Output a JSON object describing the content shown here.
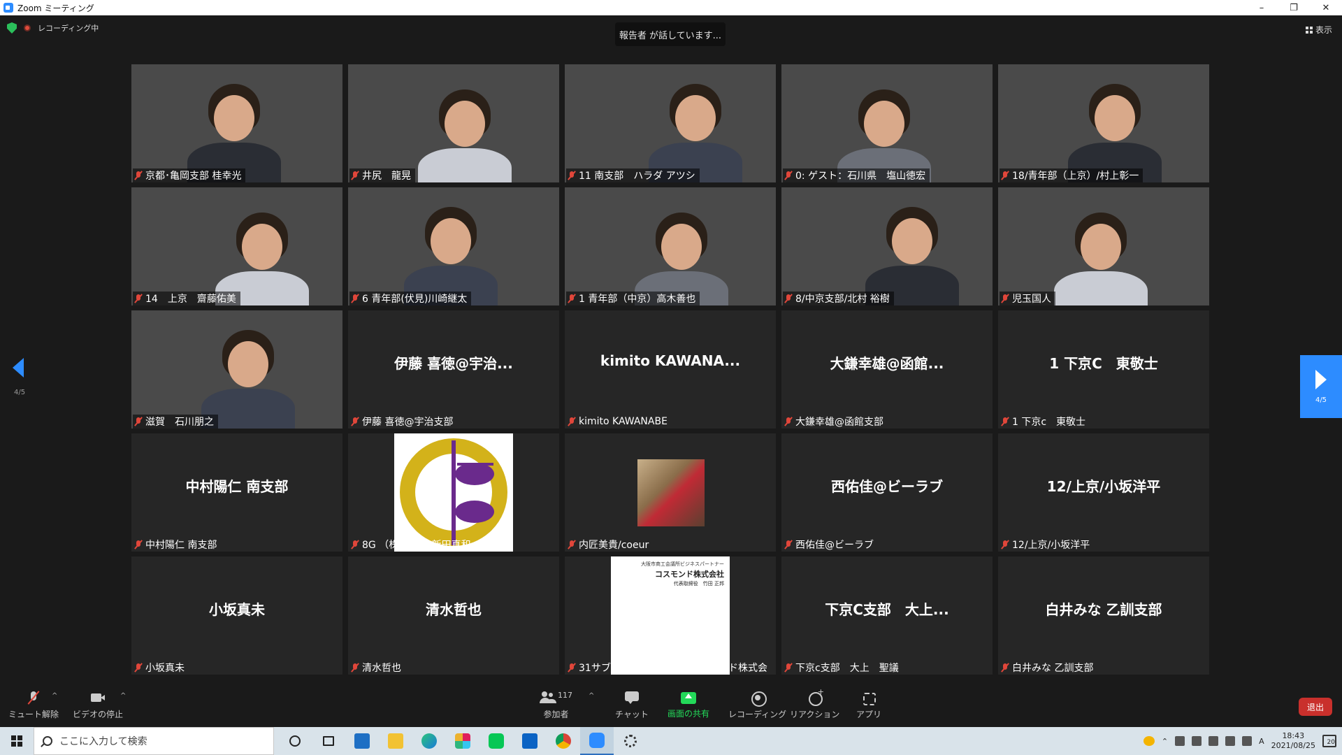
{
  "window": {
    "title": "Zoom ミーティング",
    "min": "–",
    "max": "❐",
    "close": "✕"
  },
  "meeting": {
    "recording_label": "レコーディング中",
    "speaking_banner": "報告者 が話しています...",
    "view_label": "表示",
    "page_indicator": "4/5"
  },
  "tiles": [
    {
      "name": "京都･亀岡支部 桂幸光",
      "kind": "video",
      "bg": "room"
    },
    {
      "name": "井尻　龍晃",
      "kind": "video",
      "bg": "office"
    },
    {
      "name": "11 南支部　ハラダ アツシ",
      "kind": "video",
      "bg": "sdgs"
    },
    {
      "name": "0: ゲスト：石川県　塩山徳宏",
      "kind": "video",
      "bg": "office"
    },
    {
      "name": "18/青年部（上京）/村上彰一",
      "kind": "video",
      "bg": "sdgs"
    },
    {
      "name": "14　上京　齋藤佑美",
      "kind": "video",
      "bg": "sdgs"
    },
    {
      "name": "6 青年部(伏見)川崎継太",
      "kind": "video",
      "bg": "sdgs"
    },
    {
      "name": "1 青年部（中京）高木善也",
      "kind": "video",
      "bg": "sdgs"
    },
    {
      "name": "8/中京支部/北村 裕樹",
      "kind": "video",
      "bg": "sdgs"
    },
    {
      "name": "児玉国人",
      "kind": "video",
      "bg": "sdgs"
    },
    {
      "name": "滋賀　石川朋之",
      "kind": "video",
      "bg": "city"
    },
    {
      "name": "伊藤 喜徳@宇治支部",
      "big": "伊藤 喜徳@宇治...",
      "kind": "plain"
    },
    {
      "name": "kimito KAWANABE",
      "big": "kimito  KAWANA...",
      "kind": "plain"
    },
    {
      "name": "大鎌幸雄@函館支部",
      "big": "大鎌幸雄@函館...",
      "kind": "plain"
    },
    {
      "name": "1 下京c　東敬士",
      "big": "1 下京C　東敬士",
      "kind": "plain"
    },
    {
      "name": "中村陽仁 南支部",
      "big": "中村陽仁 南支部",
      "kind": "plain"
    },
    {
      "name": "8G （株)新和　新田真和",
      "kind": "logo"
    },
    {
      "name": "内匠美貴/coeur",
      "kind": "photo"
    },
    {
      "name": "西佑佳@ビーラブ",
      "big": "西佑佳@ビーラブ",
      "kind": "plain"
    },
    {
      "name": "12/上京/小坂洋平",
      "big": "12/上京/小坂洋平",
      "kind": "plain"
    },
    {
      "name": "小坂真未",
      "big": "小坂真未",
      "kind": "plain"
    },
    {
      "name": "清水哲也",
      "big": "清水哲也",
      "kind": "plain"
    },
    {
      "name": "31サブ/兵庫県/竹田正邦/コスモンド株式会",
      "kind": "doc"
    },
    {
      "name": "下京c支部　大上　聖議",
      "big": "下京C支部　大上...",
      "kind": "plain"
    },
    {
      "name": "白井みな 乙訓支部",
      "big": "白井みな 乙訓支部",
      "kind": "plain"
    }
  ],
  "doc": {
    "line1": "大阪市商工会議所ビジネスパートナー",
    "line2": "コスモンド株式会社",
    "line3": "代表取締役　竹田 正邦"
  },
  "toolbar": {
    "unmute": "ミュート解除",
    "stop_video": "ビデオの停止",
    "participants": "参加者",
    "participants_count": "117",
    "chat": "チャット",
    "share": "画面の共有",
    "record": "レコーディング",
    "reactions": "リアクション",
    "apps": "アプリ",
    "leave": "退出",
    "caret": "^"
  },
  "taskbar": {
    "search_placeholder": "ここに入力して検索",
    "time": "18:43",
    "date": "2021/08/25",
    "ime": "A",
    "notifications": "20"
  },
  "colors": {
    "accent": "#2d8cff",
    "share_green": "#23d959",
    "leave_red": "#c9302c",
    "muted_red": "#e0463a"
  }
}
